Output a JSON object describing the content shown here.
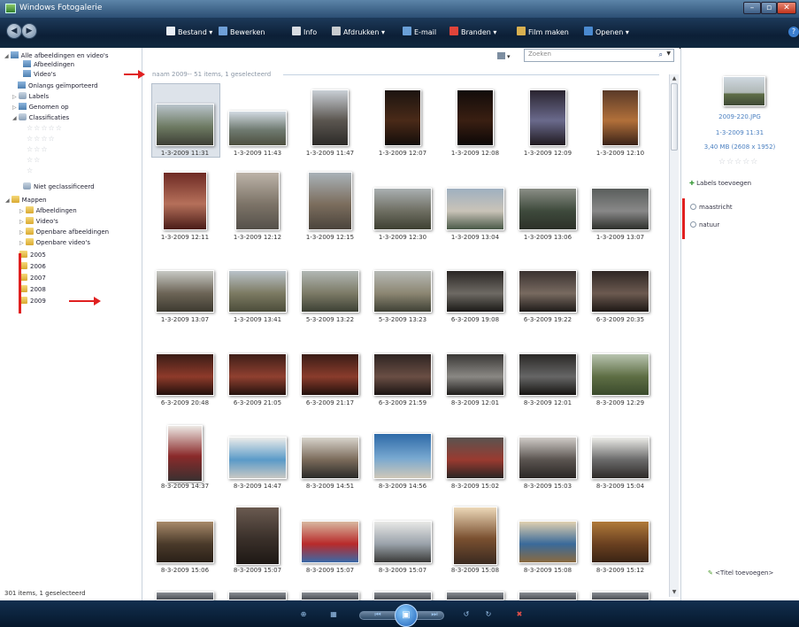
{
  "window": {
    "title": "Windows Fotogalerie"
  },
  "toolbar": {
    "items": [
      {
        "label": "Bestand",
        "icon": "file-icon",
        "dropdown": true
      },
      {
        "label": "Bewerken",
        "icon": "edit-icon",
        "dropdown": false
      },
      {
        "label": "Info",
        "icon": "info-icon",
        "dropdown": false
      },
      {
        "label": "Afdrukken",
        "icon": "printer-icon",
        "dropdown": true
      },
      {
        "label": "E-mail",
        "icon": "email-icon",
        "dropdown": false
      },
      {
        "label": "Branden",
        "icon": "burn-disc-icon",
        "dropdown": true
      },
      {
        "label": "Film maken",
        "icon": "film-icon",
        "dropdown": false
      },
      {
        "label": "Openen",
        "icon": "open-icon",
        "dropdown": true
      }
    ]
  },
  "nav": {
    "items": [
      {
        "label": "Alle afbeeldingen en video's",
        "icon": "gallery-icon",
        "expander": "◢"
      },
      {
        "label": "Afbeeldingen",
        "icon": "images-icon"
      },
      {
        "label": "Video's",
        "icon": "video-icon"
      },
      {
        "label": "Onlangs geïmporteerd",
        "icon": "import-icon"
      },
      {
        "label": "Labels",
        "icon": "tag-icon",
        "expander": "▷"
      },
      {
        "label": "Genomen op",
        "icon": "calendar-icon",
        "expander": "▷"
      },
      {
        "label": "Classificaties",
        "icon": "star-icon",
        "expander": "◢"
      },
      {
        "label": "Niet geclassificeerd",
        "icon": "star-icon"
      },
      {
        "label": "Mappen",
        "icon": "folder-icon",
        "expander": "◢"
      },
      {
        "label": "Afbeeldingen",
        "icon": "folder-icon",
        "expander": "▷"
      },
      {
        "label": "Video's",
        "icon": "folder-icon",
        "expander": "▷"
      },
      {
        "label": "Openbare afbeeldingen",
        "icon": "folder-icon",
        "expander": "▷"
      },
      {
        "label": "Openbare video's",
        "icon": "folder-icon",
        "expander": "▷"
      },
      {
        "label": "2005",
        "icon": "folder-icon"
      },
      {
        "label": "2006",
        "icon": "folder-icon"
      },
      {
        "label": "2007",
        "icon": "folder-icon"
      },
      {
        "label": "2008",
        "icon": "folder-icon"
      },
      {
        "label": "2009",
        "icon": "folder-icon"
      }
    ],
    "rating_rows": [
      "☆☆☆☆☆",
      "☆☆☆☆",
      "☆☆☆",
      "☆☆",
      "☆"
    ],
    "status": "301 items, 1 geselecteerd"
  },
  "group_label": "naam 2009-- 51 items, 1 geselecteerd",
  "search": {
    "placeholder": "Zoeken",
    "icon": "search-icon"
  },
  "view_button": "▾",
  "photos": [
    {
      "caption": "1-3-2009 11:31",
      "selected": true,
      "colors": [
        "#b9c4cc",
        "#6d7a62",
        "#3d3e35"
      ]
    },
    {
      "caption": "1-3-2009 11:43",
      "colors": [
        "#d2dae2",
        "#6f7a70",
        "#4e4f3f"
      ]
    },
    {
      "caption": "1-3-2009 11:47",
      "colors": [
        "#c9cfd6",
        "#5b5650",
        "#2c2a28"
      ]
    },
    {
      "caption": "1-3-2009 12:07",
      "colors": [
        "#1c1410",
        "#4a2a18",
        "#130d0a"
      ]
    },
    {
      "caption": "1-3-2009 12:08",
      "colors": [
        "#120c0a",
        "#3a1f12",
        "#0b0706"
      ]
    },
    {
      "caption": "1-3-2009 12:09",
      "colors": [
        "#2a2430",
        "#6a6a8c",
        "#201a20"
      ]
    },
    {
      "caption": "1-3-2009 12:10",
      "colors": [
        "#5a3a28",
        "#b2703a",
        "#3a2218"
      ]
    },
    {
      "caption": "1-3-2009 12:11",
      "colors": [
        "#6e2a24",
        "#b5705a",
        "#4a1c18"
      ]
    },
    {
      "caption": "1-3-2009 12:12",
      "colors": [
        "#bcb3a8",
        "#7d7468",
        "#55504a"
      ]
    },
    {
      "caption": "1-3-2009 12:15",
      "colors": [
        "#a9b2b8",
        "#7c6e5e",
        "#4b443c"
      ]
    },
    {
      "caption": "1-3-2009 12:30",
      "colors": [
        "#aab0b2",
        "#6e6e62",
        "#3e4032"
      ]
    },
    {
      "caption": "1-3-2009 13:04",
      "colors": [
        "#9fb0c0",
        "#c9c3b8",
        "#4a5a48"
      ]
    },
    {
      "caption": "1-3-2009 13:06",
      "colors": [
        "#8a8e86",
        "#3e4a3c",
        "#2c3028"
      ]
    },
    {
      "caption": "1-3-2009 13:07",
      "colors": [
        "#5a5e5c",
        "#888",
        "#2e302c"
      ]
    },
    {
      "caption": "1-3-2009 13:07",
      "colors": [
        "#c7c9c4",
        "#6c6456",
        "#3d3a30"
      ]
    },
    {
      "caption": "1-3-2009 13:41",
      "colors": [
        "#b9c2c9",
        "#7c7a62",
        "#4b4c3a"
      ]
    },
    {
      "caption": "5-3-2009 13:22",
      "colors": [
        "#b1b7b4",
        "#7c7a66",
        "#3c4034"
      ]
    },
    {
      "caption": "5-3-2009 13:23",
      "colors": [
        "#b7bab6",
        "#8c8672",
        "#3e4034"
      ]
    },
    {
      "caption": "6-3-2009 19:08",
      "colors": [
        "#2a2624",
        "#6e6a64",
        "#1a1816"
      ]
    },
    {
      "caption": "6-3-2009 19:22",
      "colors": [
        "#3a3230",
        "#786a60",
        "#1e1a18"
      ]
    },
    {
      "caption": "6-3-2009 20:35",
      "colors": [
        "#2e2624",
        "#6c5a50",
        "#1c1614"
      ]
    },
    {
      "caption": "6-3-2009 20:48",
      "colors": [
        "#3a1c16",
        "#8e3a2a",
        "#22100c"
      ]
    },
    {
      "caption": "6-3-2009 21:05",
      "colors": [
        "#3e1e18",
        "#904030",
        "#24120e"
      ]
    },
    {
      "caption": "6-3-2009 21:17",
      "colors": [
        "#3a1c16",
        "#8a3c2c",
        "#22100c"
      ]
    },
    {
      "caption": "6-3-2009 21:59",
      "colors": [
        "#2e2422",
        "#6a4e44",
        "#1a1412"
      ]
    },
    {
      "caption": "8-3-2009 12:01",
      "colors": [
        "#3a3836",
        "#8a8884",
        "#1e1c1a"
      ]
    },
    {
      "caption": "8-3-2009 12:01",
      "colors": [
        "#2a2826",
        "#666",
        "#161412"
      ]
    },
    {
      "caption": "8-3-2009 12:29",
      "colors": [
        "#b8c4b0",
        "#5e6e44",
        "#3a4a2c"
      ]
    },
    {
      "caption": "8-3-2009 14:37",
      "colors": [
        "#ece8e4",
        "#8a2a2a",
        "#3a3030"
      ]
    },
    {
      "caption": "8-3-2009 14:47",
      "colors": [
        "#ececea",
        "#5a9ac8",
        "#c8c8c4"
      ]
    },
    {
      "caption": "8-3-2009 14:51",
      "colors": [
        "#d8d4cc",
        "#7a6a5a",
        "#2a2a28"
      ]
    },
    {
      "caption": "8-3-2009 14:56",
      "colors": [
        "#2e6aa8",
        "#78a8d0",
        "#d0c8b8"
      ]
    },
    {
      "caption": "8-3-2009 15:02",
      "colors": [
        "#5a5450",
        "#9a3a30",
        "#2a2624"
      ]
    },
    {
      "caption": "8-3-2009 15:03",
      "colors": [
        "#d0ccc8",
        "#5a5450",
        "#2a2624"
      ]
    },
    {
      "caption": "8-3-2009 15:04",
      "colors": [
        "#ecece8",
        "#6a6a6a",
        "#2e2a28"
      ]
    },
    {
      "caption": "8-3-2009 15:06",
      "colors": [
        "#a88a6a",
        "#4a3a2a",
        "#2a2018"
      ]
    },
    {
      "caption": "8-3-2009 15:07",
      "colors": [
        "#6a5a50",
        "#3a302a",
        "#1e1814"
      ]
    },
    {
      "caption": "8-3-2009 15:07",
      "colors": [
        "#d8b8a0",
        "#b82a2a",
        "#3a6aa8"
      ]
    },
    {
      "caption": "8-3-2009 15:07",
      "colors": [
        "#e8e8e6",
        "#9aa2aa",
        "#3a3a38"
      ]
    },
    {
      "caption": "8-3-2009 15:08",
      "colors": [
        "#ecd8b8",
        "#7a5030",
        "#3a2a20"
      ]
    },
    {
      "caption": "8-3-2009 15:08",
      "colors": [
        "#e0d0b0",
        "#3a6a9a",
        "#8a6a40"
      ]
    },
    {
      "caption": "8-3-2009 15:12",
      "colors": [
        "#b07a3a",
        "#6a4020",
        "#3a2414"
      ]
    }
  ],
  "info": {
    "filename": "2009-220.JPG",
    "datetime": "1-3-2009  11:31",
    "size": "3,40 MB (2608 x 1952)",
    "stars": "☆☆☆☆☆",
    "add_labels": "Labels toevoegen",
    "tags": [
      "maastricht",
      "natuur"
    ],
    "add_title": "<Titel toevoegen>"
  },
  "bottom": {
    "buttons": [
      "zoom-icon",
      "actual-size-icon",
      "previous-icon",
      "slideshow-icon",
      "next-icon",
      "rotate-left-icon",
      "rotate-right-icon",
      "delete-icon"
    ]
  },
  "colors": {
    "accent": "#4a7fc0",
    "annotation": "#e02020",
    "titlebar": "#2c4f74"
  }
}
